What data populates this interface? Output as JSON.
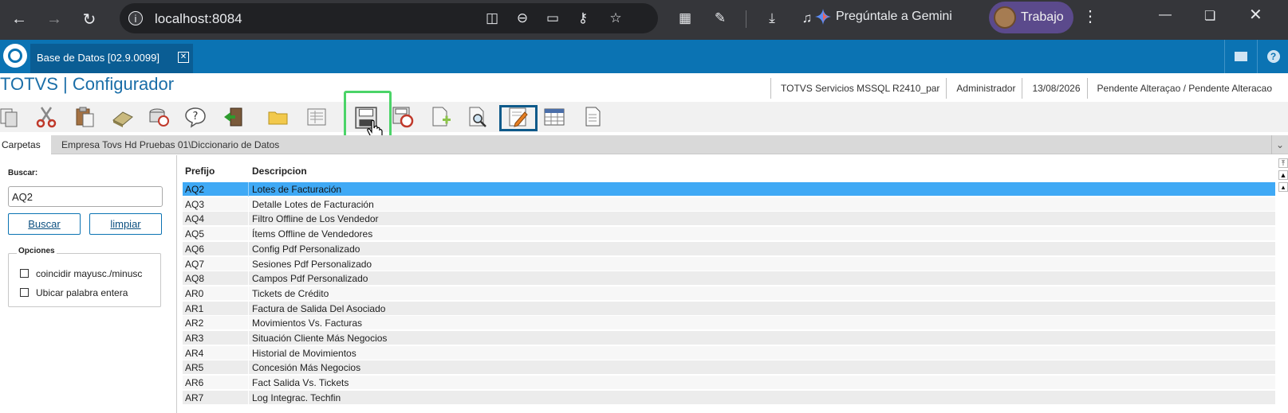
{
  "browser": {
    "url": "localhost:8084",
    "gemini_label": "Pregúntale a Gemini",
    "profile_label": "Trabajo"
  },
  "app": {
    "tab_title": "Base de Datos [02.9.0099]",
    "title": "TOTVS | Configurador",
    "info": {
      "environment": "TOTVS Servicios MSSQL R2410_par",
      "user": "Administrador",
      "date": "13/08/2026",
      "status": "Pendente Alteraçao / Pendente Alteracao"
    }
  },
  "folderbar": {
    "label": "Carpetas",
    "path": "Empresa Tovs Hd Pruebas 01\\Diccionario de Datos"
  },
  "search": {
    "label": "Buscar:",
    "value": "AQ2",
    "buscar_button": "Buscar",
    "limpiar_button": "limpiar",
    "options_legend": "Opciones",
    "option_case": "coincidir mayusc./minusc",
    "option_whole": "Ubicar palabra entera"
  },
  "grid": {
    "headers": [
      "Prefijo",
      "Descripcion"
    ],
    "rows": [
      [
        "AQ2",
        "Lotes de Facturación"
      ],
      [
        "AQ3",
        "Detalle Lotes de Facturación"
      ],
      [
        "AQ4",
        "Filtro Offline de Los Vendedor"
      ],
      [
        "AQ5",
        "Ítems Offline de Vendedores"
      ],
      [
        "AQ6",
        "Config Pdf Personalizado"
      ],
      [
        "AQ7",
        "Sesiones Pdf Personalizado"
      ],
      [
        "AQ8",
        "Campos Pdf Personalizado"
      ],
      [
        "AR0",
        "Tickets de Crédito"
      ],
      [
        "AR1",
        "Factura de Salida Del Asociado"
      ],
      [
        "AR2",
        "Movimientos Vs. Facturas"
      ],
      [
        "AR3",
        "Situación Cliente Más Negocios"
      ],
      [
        "AR4",
        "Historial de Movimientos"
      ],
      [
        "AR5",
        "Concesión Más Negocios"
      ],
      [
        "AR6",
        "Fact Salida Vs. Tickets"
      ],
      [
        "AR7",
        "Log Integrac. Techfin"
      ]
    ]
  },
  "toolbar_icons": [
    "copy-icon",
    "cut-icon",
    "paste-icon",
    "eraser-icon",
    "database-icon",
    "help-icon",
    "exit-icon",
    "folder-icon",
    "list-icon",
    "save-icon",
    "schedule-save-icon",
    "add-document-icon",
    "preview-icon",
    "edit-icon",
    "table-icon",
    "document-icon"
  ],
  "colors": {
    "chrome_bg": "#35363a",
    "app_blue": "#0b73b3",
    "selected_row": "#3fa9f5",
    "highlight_green": "#4bd468"
  }
}
